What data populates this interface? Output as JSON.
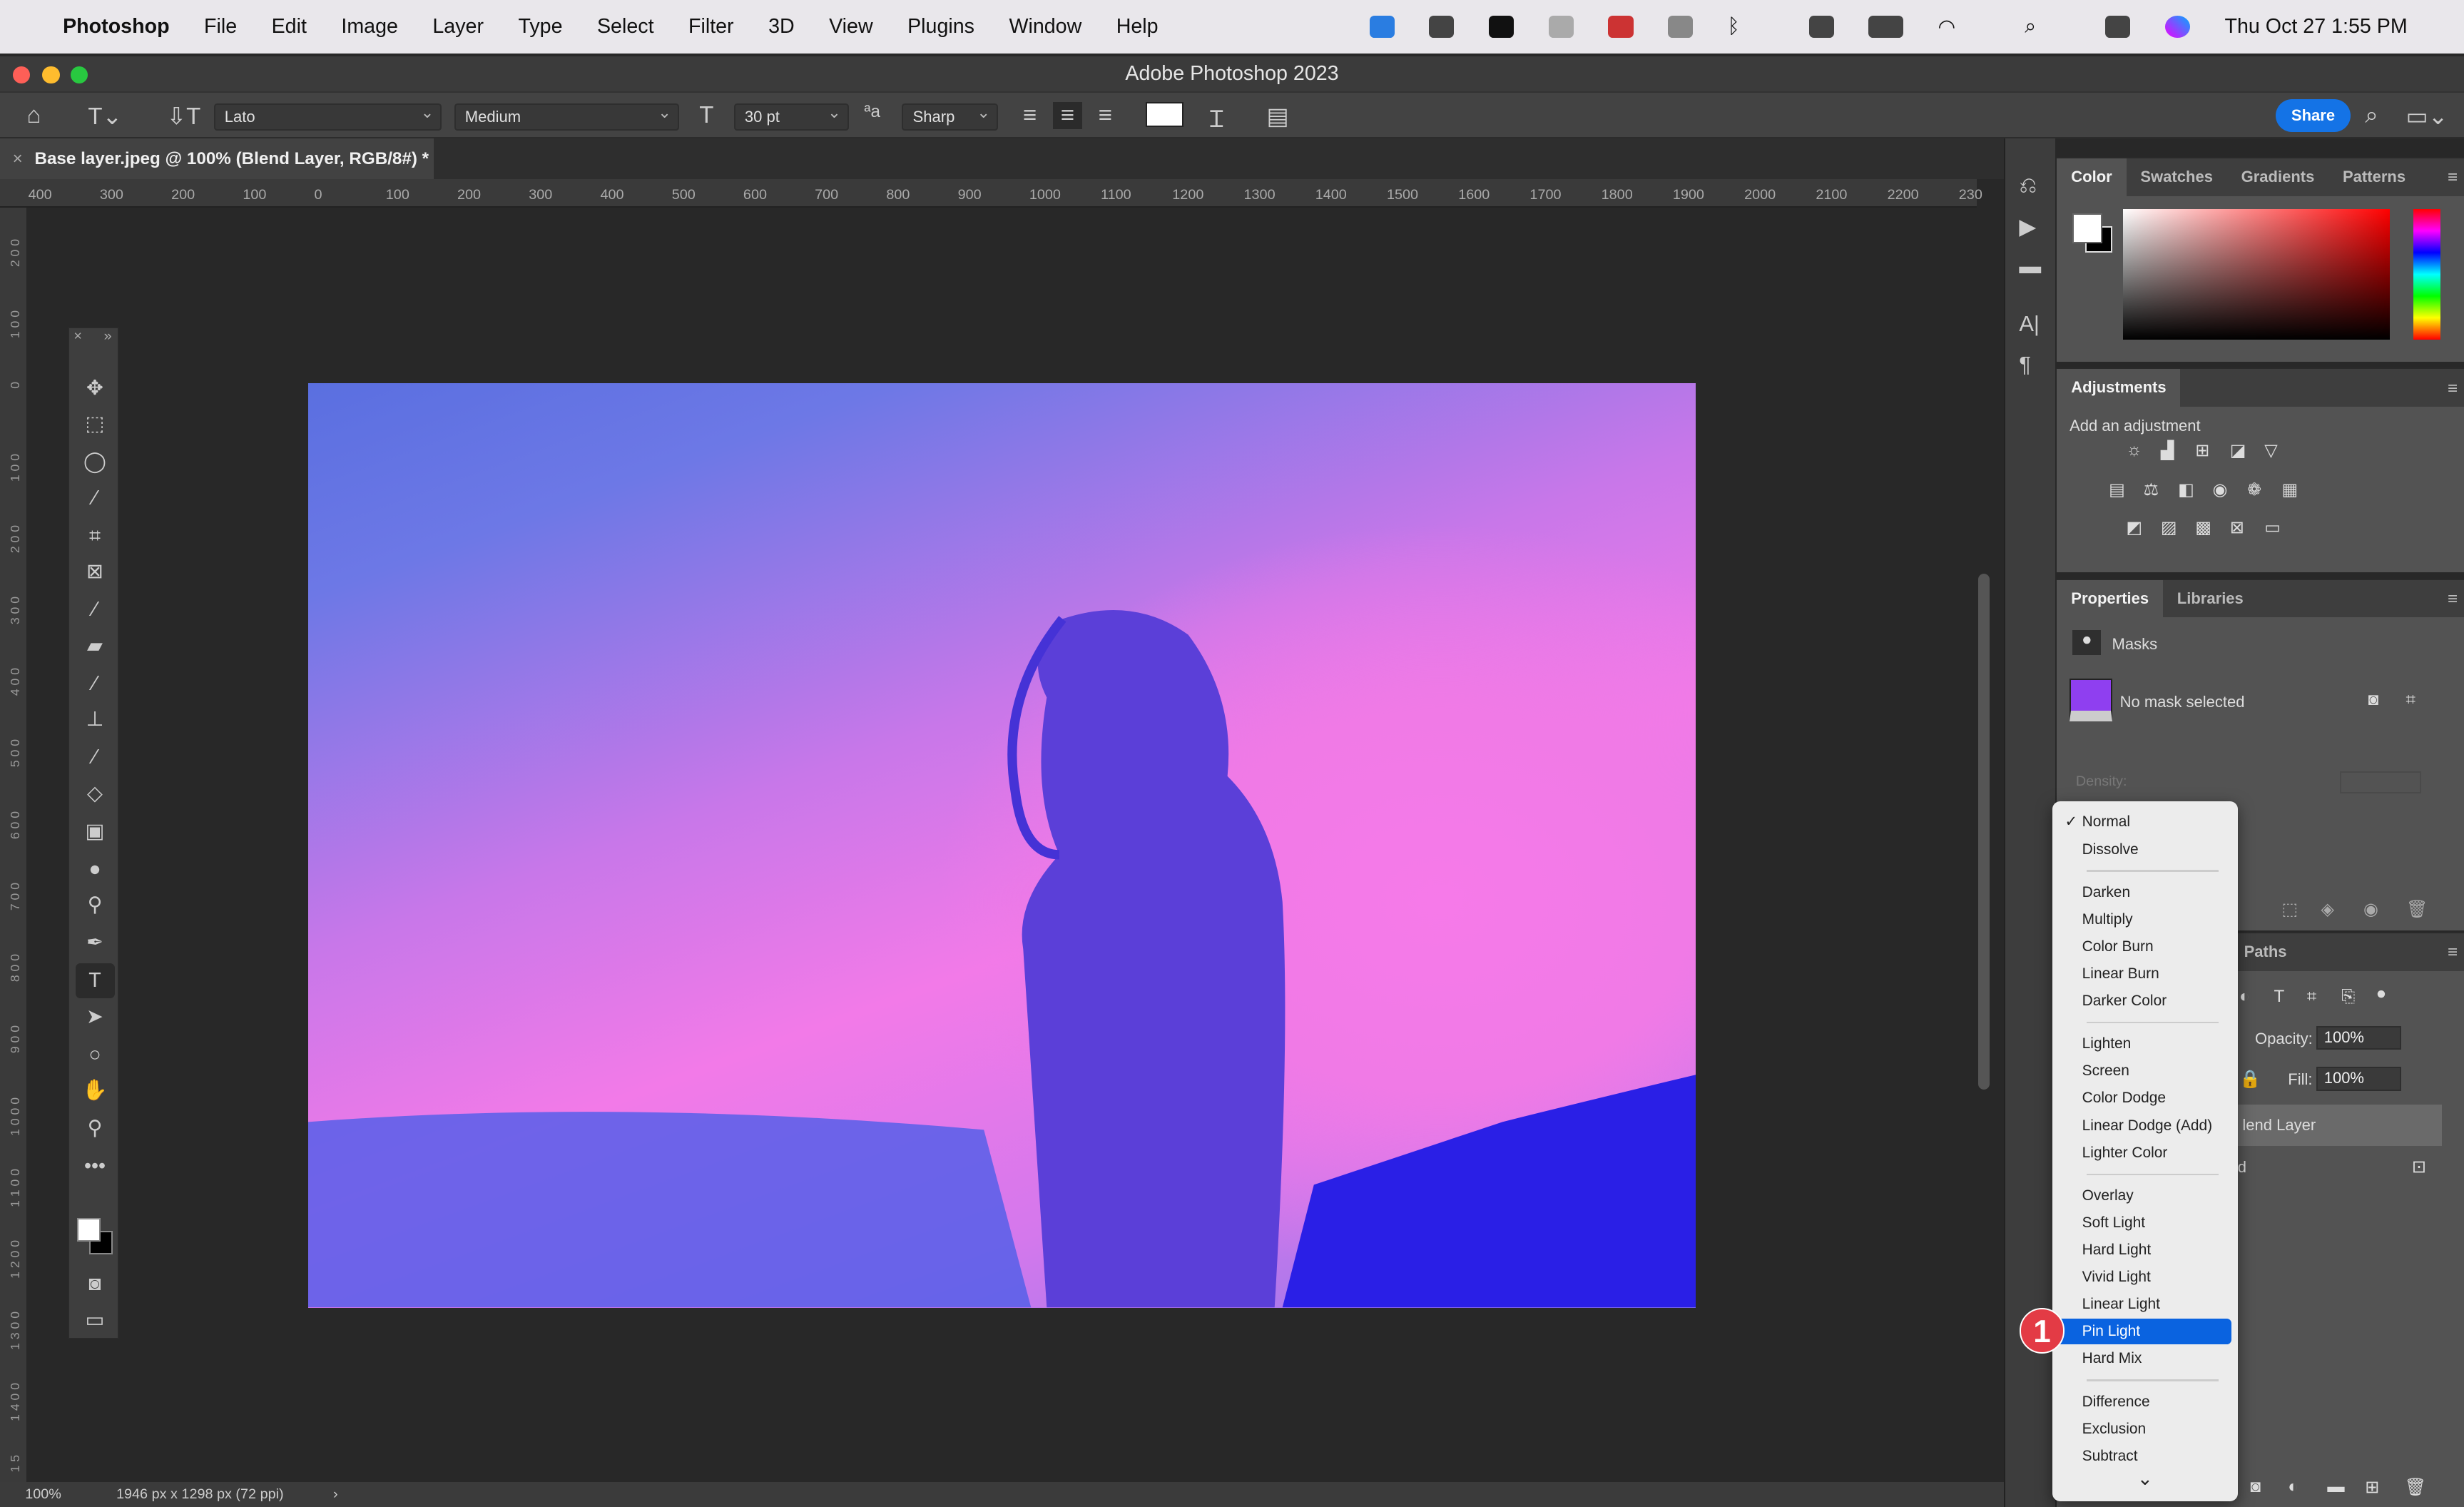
{
  "menubar": {
    "app": "Photoshop",
    "items": [
      "File",
      "Edit",
      "Image",
      "Layer",
      "Type",
      "Select",
      "Filter",
      "3D",
      "View",
      "Plugins",
      "Window",
      "Help"
    ],
    "clock": "Thu Oct 27  1:55 PM"
  },
  "window": {
    "title": "Adobe Photoshop 2023"
  },
  "options": {
    "font_family": "Lato",
    "font_style": "Medium",
    "font_size": "30 pt",
    "antialias": "Sharp",
    "share": "Share",
    "text_color": "#ffffff"
  },
  "document": {
    "tab": "Base layer.jpeg @ 100% (Blend Layer, RGB/8#) *",
    "zoom": "100%",
    "dimensions": "1946 px x 1298 px (72 ppi)"
  },
  "ruler": {
    "h": [
      "400",
      "300",
      "200",
      "100",
      "0",
      "100",
      "200",
      "300",
      "400",
      "500",
      "600",
      "700",
      "800",
      "900",
      "1000",
      "1100",
      "1200",
      "1300",
      "1400",
      "1500",
      "1600",
      "1700",
      "1800",
      "1900",
      "2000",
      "2100",
      "2200",
      "230"
    ],
    "v": [
      "2 0 0",
      "1 0 0",
      "0",
      "1 0 0",
      "2 0 0",
      "3 0 0",
      "4 0 0",
      "5 0 0",
      "6 0 0",
      "7 0 0",
      "8 0 0",
      "9 0 0",
      "1 0 0 0",
      "1 1 0 0",
      "1 2 0 0",
      "1 3 0 0",
      "1 4 0 0",
      "1 5"
    ]
  },
  "color_panel": {
    "tabs": [
      "Color",
      "Swatches",
      "Gradients",
      "Patterns"
    ],
    "foreground": "#ffffff",
    "background": "#000000",
    "hue": "#ff0000"
  },
  "adjustments": {
    "title": "Adjustments",
    "subtitle": "Add an adjustment"
  },
  "properties": {
    "tabs": [
      "Properties",
      "Libraries"
    ],
    "section": "Masks",
    "mask_status": "No mask selected",
    "density_label": "Density:",
    "swatch_color": "#8f3ff0"
  },
  "layers": {
    "tab_partial": "Paths",
    "opacity_label": "Opacity:",
    "opacity": "100%",
    "fill_label": "Fill:",
    "fill": "100%",
    "layer1": "lend Layer",
    "layer2": "d"
  },
  "blend_menu": {
    "selected": "Pin Light",
    "checked": "Normal",
    "groups": [
      [
        "Normal",
        "Dissolve"
      ],
      [
        "Darken",
        "Multiply",
        "Color Burn",
        "Linear Burn",
        "Darker Color"
      ],
      [
        "Lighten",
        "Screen",
        "Color Dodge",
        "Linear Dodge (Add)",
        "Lighter Color"
      ],
      [
        "Overlay",
        "Soft Light",
        "Hard Light",
        "Vivid Light",
        "Linear Light",
        "Pin Light",
        "Hard Mix"
      ],
      [
        "Difference",
        "Exclusion",
        "Subtract"
      ]
    ],
    "highlight_color": "#0a63e0"
  },
  "callout": {
    "number": "1",
    "color": "#e33b45"
  }
}
